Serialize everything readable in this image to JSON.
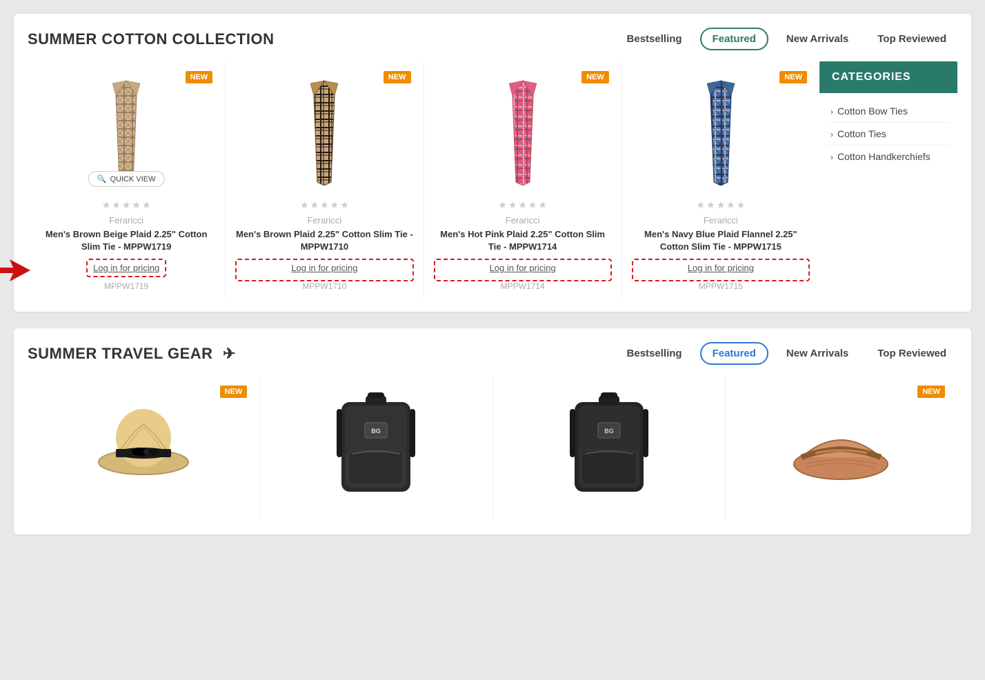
{
  "section1": {
    "title": "SUMMER COTTON COLLECTION",
    "tabs": [
      {
        "label": "Bestselling",
        "active": false
      },
      {
        "label": "Featured",
        "active": true
      },
      {
        "label": "New Arrivals",
        "active": false
      },
      {
        "label": "Top Reviewed",
        "active": false
      }
    ],
    "categories": {
      "header": "CATEGORIES",
      "items": [
        {
          "label": "Cotton Bow Ties"
        },
        {
          "label": "Cotton Ties"
        },
        {
          "label": "Cotton Handkerchiefs"
        }
      ]
    },
    "products": [
      {
        "isNew": true,
        "hasQuickView": true,
        "brand": "Feraricci",
        "name": "Men's Brown Beige Plaid 2.25\" Cotton Slim Tie - MPPW1719",
        "pricing": "Log in for pricing",
        "sku": "MPPW1719",
        "color1": "#c8a87a",
        "color2": "#8b6b4a"
      },
      {
        "isNew": true,
        "hasQuickView": false,
        "brand": "Feraricci",
        "name": "Men's Brown Plaid 2.25\" Cotton Slim Tie - MPPW1710",
        "pricing": "Log in for pricing",
        "sku": "MPPW1710",
        "color1": "#5a3e2b",
        "color2": "#1a1a2e"
      },
      {
        "isNew": true,
        "hasQuickView": false,
        "brand": "Feraricci",
        "name": "Men's Hot Pink Plaid 2.25\" Cotton Slim Tie - MPPW1714",
        "pricing": "Log in for pricing",
        "sku": "MPPW1714",
        "color1": "#e8607a",
        "color2": "#f4a0b0"
      },
      {
        "isNew": true,
        "hasQuickView": false,
        "brand": "Feraricci",
        "name": "Men's Navy Blue Plaid Flannel 2.25\" Cotton Slim Tie - MPPW1715",
        "pricing": "Log in for pricing",
        "sku": "MPPW1715",
        "color1": "#1a3a6b",
        "color2": "#4a7ab5"
      }
    ],
    "newBadge": "NEW",
    "quickView": "QUICK VIEW",
    "stars": [
      "★",
      "★",
      "★",
      "★",
      "★"
    ]
  },
  "section2": {
    "title": "SUMMER TRAVEL GEAR",
    "planeIcon": "✈",
    "tabs": [
      {
        "label": "Bestselling",
        "active": false
      },
      {
        "label": "Featured",
        "active": true
      },
      {
        "label": "New Arrivals",
        "active": false
      },
      {
        "label": "Top Reviewed",
        "active": false
      }
    ],
    "products": [
      {
        "isNew": true,
        "type": "hat",
        "label": "straw-hat"
      },
      {
        "isNew": false,
        "type": "backpack",
        "label": "BG"
      },
      {
        "isNew": false,
        "type": "backpack",
        "label": "BG"
      },
      {
        "isNew": true,
        "type": "visor",
        "label": "visor-hat"
      }
    ],
    "newBadge": "NEW"
  }
}
